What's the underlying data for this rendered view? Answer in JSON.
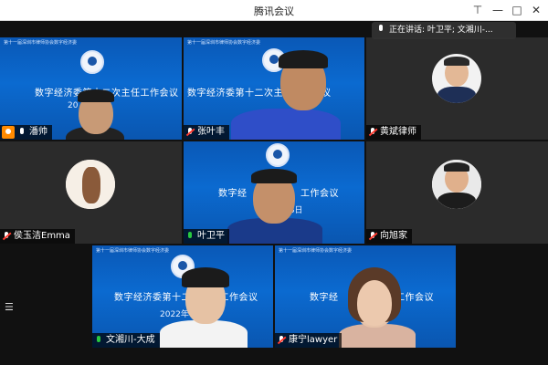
{
  "window": {
    "title": "腾讯会议",
    "pin": "⊤",
    "minimize": "—",
    "maximize": "□",
    "close": "✕"
  },
  "speaking": {
    "label": "正在讲话: 叶卫平; 文湘川-..."
  },
  "background": {
    "org": "第十一届深圳市律师协会数字经济委",
    "meeting_visible_1": "数字经济委第十二次主任工作会议",
    "meeting_visible_2": "数字经",
    "meeting_visible_3": "工作会议",
    "date_frag_1": "20",
    "date_frag_2": "28日",
    "date_frag_3": "2022年8"
  },
  "participants": [
    {
      "name": "潘帅",
      "mic": "host"
    },
    {
      "name": "张叶丰",
      "mic": "muted"
    },
    {
      "name": "黄斌律师",
      "mic": "muted"
    },
    {
      "name": "侯玉洁Emma",
      "mic": "muted"
    },
    {
      "name": "叶卫平",
      "mic": "speaking"
    },
    {
      "name": "向旭家",
      "mic": "muted"
    },
    {
      "name": "文湘川-大成",
      "mic": "speaking"
    },
    {
      "name": "康宁lawyer",
      "mic": "muted"
    }
  ],
  "colors": {
    "tile_blue": "#0b6ad0",
    "mic_green": "#28c840",
    "mute_red": "#ff3b30",
    "host_orange": "#ff8a00"
  },
  "icons": {
    "menu": "☰"
  }
}
